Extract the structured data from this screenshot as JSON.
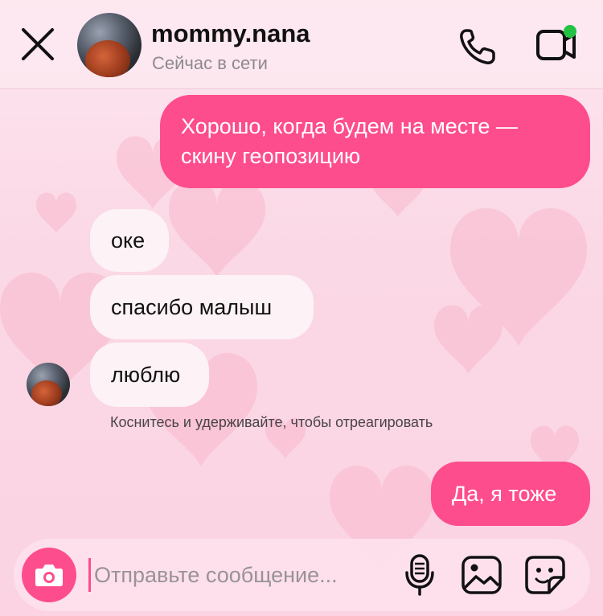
{
  "header": {
    "username": "mommy.nana",
    "status": "Сейчас в сети",
    "icons": [
      "close-icon",
      "phone-icon",
      "video-call-icon"
    ]
  },
  "messages": [
    {
      "direction": "outgoing",
      "lines": [
        "Хорошо, когда будем на месте —",
        "скину геопозицию"
      ]
    },
    {
      "direction": "incoming",
      "text": "оке"
    },
    {
      "direction": "incoming",
      "text": "спасибо малыш"
    },
    {
      "direction": "incoming",
      "text": "люблю"
    },
    {
      "direction": "outgoing",
      "text": "Да, я тоже"
    }
  ],
  "hint": "Коснитесь и удерживайте, чтобы отреагировать",
  "composer": {
    "placeholder": "Отправьте сообщение...",
    "icons": [
      "camera-icon",
      "microphone-icon",
      "gallery-icon",
      "sticker-icon"
    ]
  },
  "colors": {
    "accent": "#fe4d8c",
    "incoming_bubble": "#fdf2f5",
    "online": "#22c244",
    "background": "#fbd8e6"
  }
}
